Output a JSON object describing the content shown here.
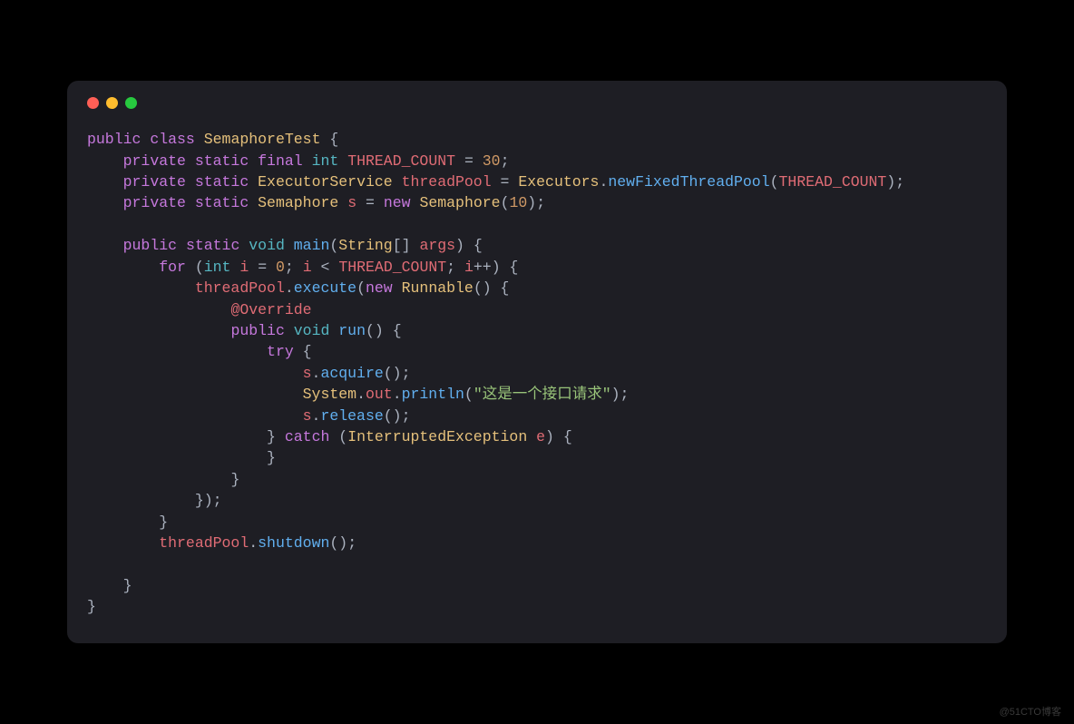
{
  "watermark": "@51CTO博客",
  "code": {
    "l1": {
      "public": "public",
      "class": "class",
      "SemaphoreTest": "SemaphoreTest",
      "ob": "{"
    },
    "l2": {
      "indent": "    ",
      "private": "private",
      "static": "static",
      "final": "final",
      "int": "int",
      "name": "THREAD_COUNT",
      "eq": "=",
      "val": "30",
      "sc": ";"
    },
    "l3": {
      "indent": "    ",
      "private": "private",
      "static": "static",
      "ExecutorService": "ExecutorService",
      "threadPool": "threadPool",
      "eq": "=",
      "Executors": "Executors",
      "dot": ".",
      "newFixedThreadPool": "newFixedThreadPool",
      "op": "(",
      "arg": "THREAD_COUNT",
      "cp": ")",
      "sc": ";"
    },
    "l4": {
      "indent": "    ",
      "private": "private",
      "static": "static",
      "Semaphore": "Semaphore",
      "s": "s",
      "eq": "=",
      "new": "new",
      "Semaphore2": "Semaphore",
      "op": "(",
      "val": "10",
      "cp": ")",
      "sc": ";"
    },
    "l6": {
      "indent": "    ",
      "public": "public",
      "static": "static",
      "void": "void",
      "main": "main",
      "op": "(",
      "String": "String",
      "br": "[]",
      "args": "args",
      "cp": ")",
      "ob": "{"
    },
    "l7": {
      "indent": "        ",
      "for": "for",
      "op": "(",
      "int": "int",
      "i": "i",
      "eq": "=",
      "zero": "0",
      "sc": ";",
      "i2": "i",
      "lt": "<",
      "tc": "THREAD_COUNT",
      "sc2": ";",
      "i3": "i",
      "pp": "++",
      "cp": ")",
      "ob": "{"
    },
    "l8": {
      "indent": "            ",
      "threadPool": "threadPool",
      "dot": ".",
      "execute": "execute",
      "op": "(",
      "new": "new",
      "Runnable": "Runnable",
      "pp": "()",
      "ob": "{"
    },
    "l9": {
      "indent": "                ",
      "ann": "@Override"
    },
    "l10": {
      "indent": "                ",
      "public": "public",
      "void": "void",
      "run": "run",
      "pp": "()",
      "ob": "{"
    },
    "l11": {
      "indent": "                    ",
      "try": "try",
      "ob": "{"
    },
    "l12": {
      "indent": "                        ",
      "s": "s",
      "dot": ".",
      "acquire": "acquire",
      "pp": "()",
      "sc": ";"
    },
    "l13": {
      "indent": "                        ",
      "System": "System",
      "d1": ".",
      "out": "out",
      "d2": ".",
      "println": "println",
      "op": "(",
      "str": "\"这是一个接口请求\"",
      "cp": ")",
      "sc": ";"
    },
    "l14": {
      "indent": "                        ",
      "s": "s",
      "dot": ".",
      "release": "release",
      "pp": "()",
      "sc": ";"
    },
    "l15": {
      "indent": "                    ",
      "cb": "}",
      "catch": "catch",
      "op": "(",
      "IE": "InterruptedException",
      "e": "e",
      "cp": ")",
      "ob": "{"
    },
    "l16": {
      "indent": "                    ",
      "cb": "}"
    },
    "l17": {
      "indent": "                ",
      "cb": "}"
    },
    "l18": {
      "indent": "            ",
      "cb": "})",
      "sc": ";"
    },
    "l19": {
      "indent": "        ",
      "cb": "}"
    },
    "l20": {
      "indent": "        ",
      "threadPool": "threadPool",
      "dot": ".",
      "shutdown": "shutdown",
      "pp": "()",
      "sc": ";"
    },
    "l22": {
      "indent": "    ",
      "cb": "}"
    },
    "l23": {
      "cb": "}"
    }
  }
}
